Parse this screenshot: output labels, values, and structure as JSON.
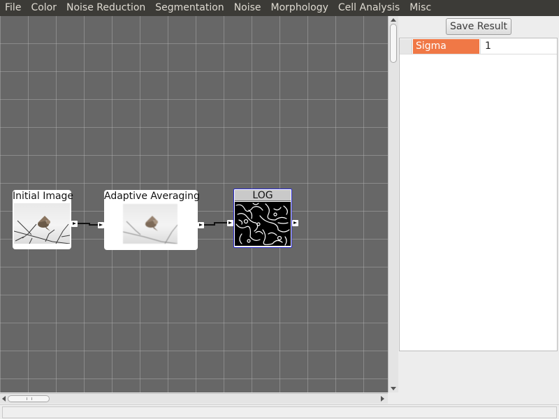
{
  "menubar": {
    "items": [
      "File",
      "Color",
      "Noise Reduction",
      "Segmentation",
      "Noise",
      "Morphology",
      "Cell Analysis",
      "Misc"
    ]
  },
  "canvas": {
    "nodes": [
      {
        "title": "Initial Image",
        "thumbnail": "bird-photo"
      },
      {
        "title": "Adaptive Averaging",
        "thumbnail": "bird-photo"
      },
      {
        "title": "LOG",
        "thumbnail": "edge-map",
        "selected": true
      }
    ]
  },
  "panel": {
    "save_label": "Save Result",
    "properties": [
      {
        "name": "Sigma",
        "value": "1"
      }
    ]
  },
  "colors": {
    "menubar_bg": "#3c3b37",
    "canvas_bg": "#676767",
    "property_highlight": "#f07846",
    "selected_node_border": "#2a2ad0"
  }
}
